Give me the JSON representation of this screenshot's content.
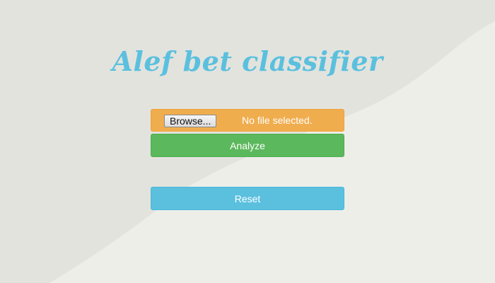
{
  "page": {
    "title": "Alef bet classifier"
  },
  "form": {
    "browse_label": "Browse...",
    "file_status": "No file selected.",
    "analyze_label": "Analyze",
    "reset_label": "Reset"
  },
  "colors": {
    "title": "#5bc0de",
    "file_row": "#f0ad4e",
    "analyze": "#5cb85c",
    "reset": "#5bc0de",
    "background_dark": "#e3e3de",
    "background_light": "#eeeee9"
  }
}
